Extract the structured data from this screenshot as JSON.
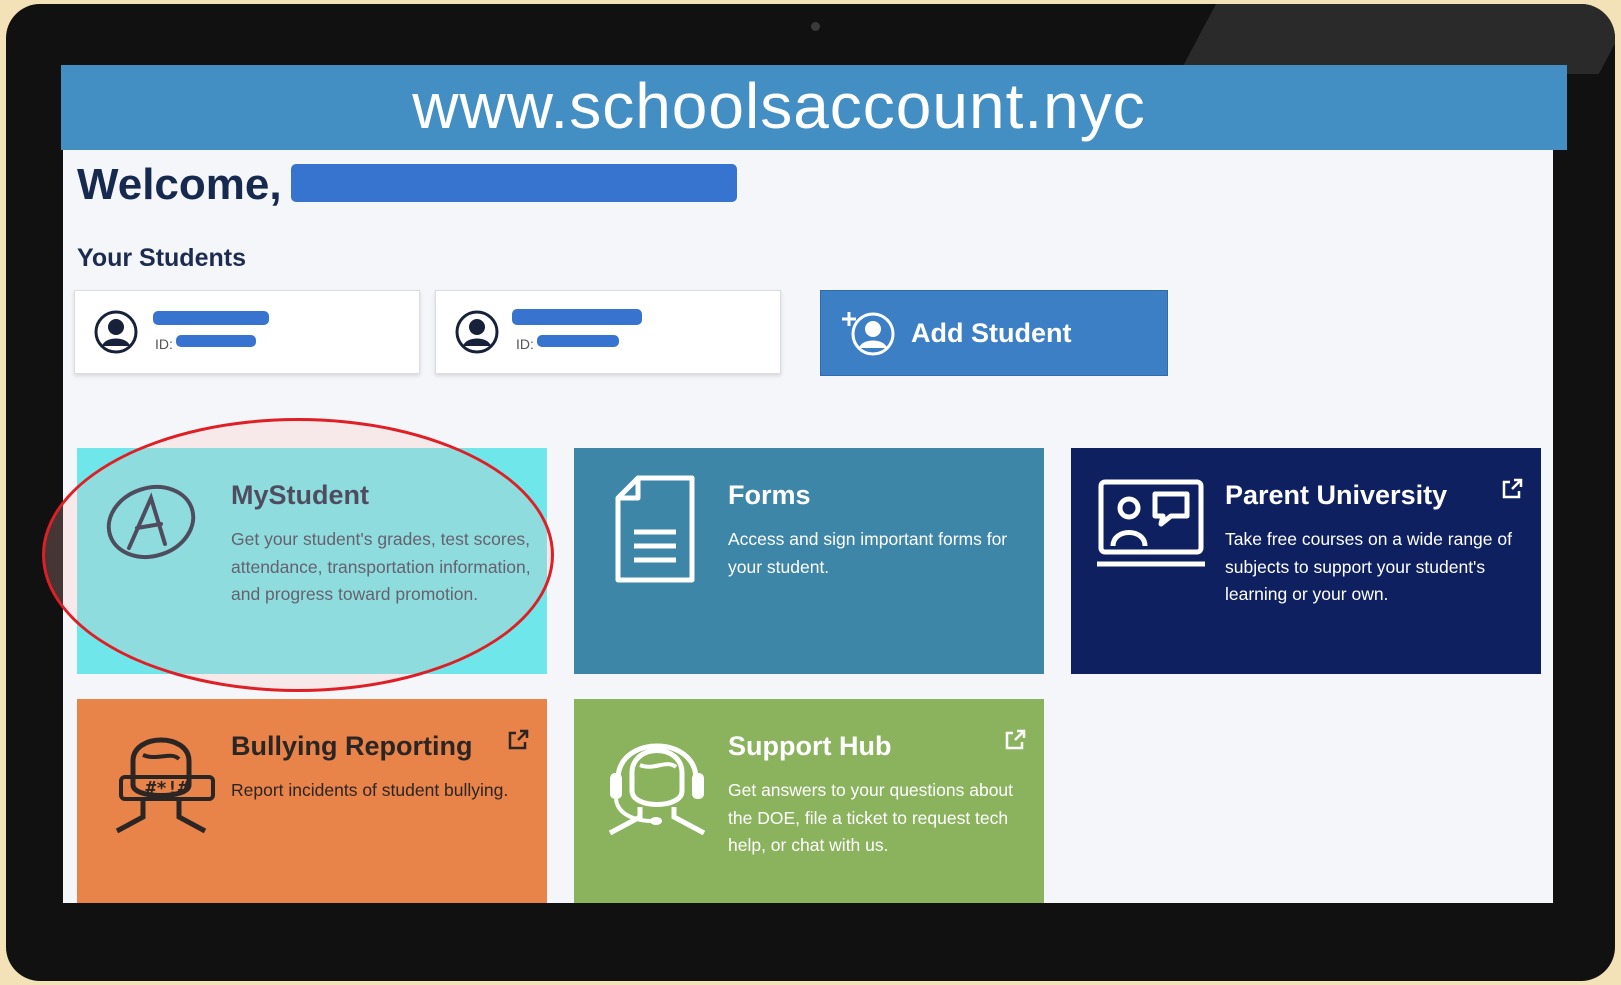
{
  "banner": {
    "url_text": "www.schoolsaccount.nyc"
  },
  "header": {
    "welcome": "Welcome,"
  },
  "students": {
    "heading": "Your Students",
    "cards": [
      {
        "id_label": "ID:"
      },
      {
        "id_label": "ID:"
      }
    ],
    "add_label": "Add Student"
  },
  "tiles": {
    "mystudent": {
      "title": "MyStudent",
      "description": "Get your student's grades, test scores, attendance, transportation information, and progress toward promotion."
    },
    "forms": {
      "title": "Forms",
      "description": "Access and sign important forms for your student."
    },
    "parent_university": {
      "title": "Parent University",
      "description": "Take free courses on a wide range of subjects to support your student's learning or your own."
    },
    "bullying": {
      "title": "Bullying Reporting",
      "description": "Report incidents of student bullying."
    },
    "support": {
      "title": "Support Hub",
      "description": "Get answers to your questions about the DOE, file a ticket to request tech help, or chat with us."
    }
  },
  "colors": {
    "banner": "#438fc3",
    "mystudent": "#6fe7ea",
    "forms": "#3d86a8",
    "parent_university": "#0f2060",
    "bullying": "#e8834a",
    "support": "#8bb35e",
    "highlight": "#de1f26"
  }
}
